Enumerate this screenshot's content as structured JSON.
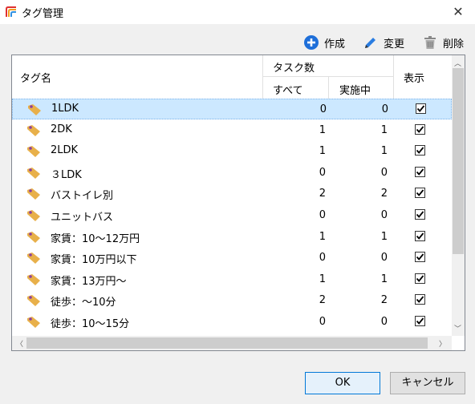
{
  "window": {
    "title": "タグ管理",
    "close": "✕"
  },
  "toolbar": {
    "create_label": "作成",
    "edit_label": "変更",
    "delete_label": "削除"
  },
  "columns": {
    "tag_name": "タグ名",
    "task_count": "タスク数",
    "all": "すべて",
    "in_progress": "実施中",
    "display": "表示"
  },
  "rows": [
    {
      "name": "1LDK",
      "all": "0",
      "in_progress": "0",
      "shown": true,
      "selected": true
    },
    {
      "name": "2DK",
      "all": "1",
      "in_progress": "1",
      "shown": true
    },
    {
      "name": "2LDK",
      "all": "1",
      "in_progress": "1",
      "shown": true
    },
    {
      "name": "３LDK",
      "all": "0",
      "in_progress": "0",
      "shown": true
    },
    {
      "name": "バストイレ別",
      "all": "2",
      "in_progress": "2",
      "shown": true
    },
    {
      "name": "ユニットバス",
      "all": "0",
      "in_progress": "0",
      "shown": true
    },
    {
      "name": "家賃：10～12万円",
      "all": "1",
      "in_progress": "1",
      "shown": true
    },
    {
      "name": "家賃：10万円以下",
      "all": "0",
      "in_progress": "0",
      "shown": true
    },
    {
      "name": "家賃：13万円～",
      "all": "1",
      "in_progress": "1",
      "shown": true
    },
    {
      "name": "徒歩：～10分",
      "all": "2",
      "in_progress": "2",
      "shown": true
    },
    {
      "name": "徒歩：10～15分",
      "all": "0",
      "in_progress": "0",
      "shown": true
    }
  ],
  "buttons": {
    "ok": "OK",
    "cancel": "キャンセル"
  },
  "colors": {
    "accent": "#0078d7",
    "selected_row": "#cce8ff",
    "create_icon": "#1e6fd9",
    "tag_icon": "#e8b04a",
    "tag_hole": "#8a3fa0"
  }
}
